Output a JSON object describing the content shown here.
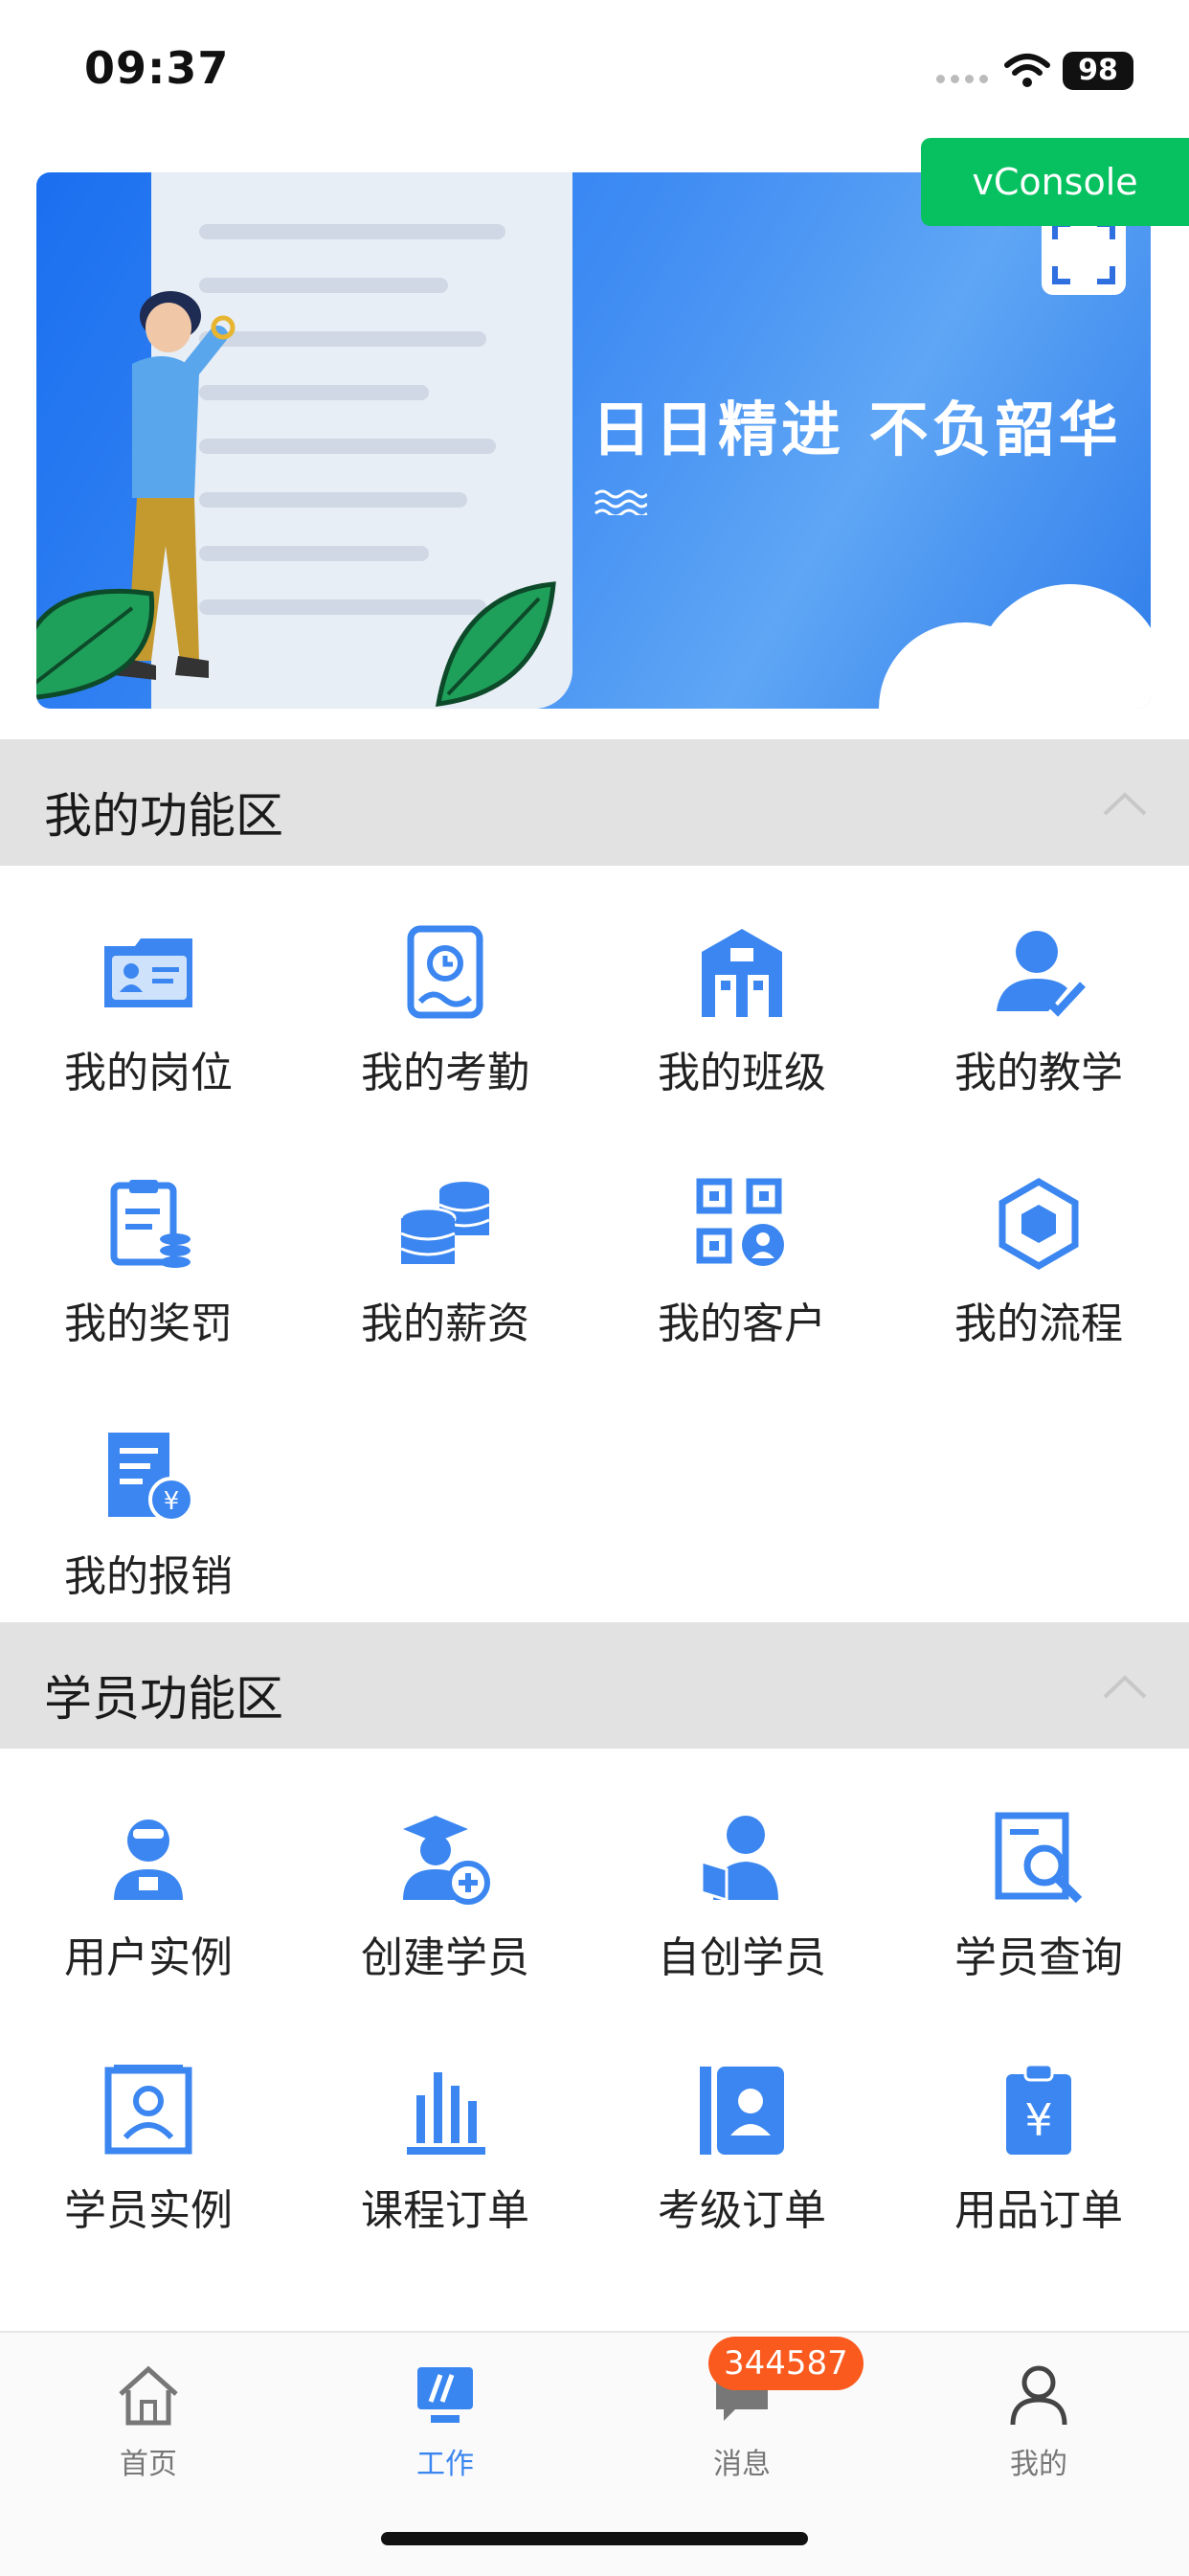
{
  "status_bar": {
    "time": "09:37",
    "battery": "98"
  },
  "banner": {
    "slogan": "日日精进 不负韶华"
  },
  "vconsole": {
    "label": "vConsole"
  },
  "sections": [
    {
      "title": "我的功能区",
      "items": [
        {
          "label": "我的岗位",
          "icon": "id-card-icon"
        },
        {
          "label": "我的考勤",
          "icon": "attendance-clock-icon"
        },
        {
          "label": "我的班级",
          "icon": "classroom-building-icon"
        },
        {
          "label": "我的教学",
          "icon": "teacher-check-icon"
        },
        {
          "label": "我的奖罚",
          "icon": "reward-clipboard-icon"
        },
        {
          "label": "我的薪资",
          "icon": "coin-stack-icon"
        },
        {
          "label": "我的客户",
          "icon": "qr-user-icon"
        },
        {
          "label": "我的流程",
          "icon": "flow-hexagon-icon"
        },
        {
          "label": "我的报销",
          "icon": "reimburse-receipt-icon"
        }
      ]
    },
    {
      "title": "学员功能区",
      "items": [
        {
          "label": "用户实例",
          "icon": "user-headset-icon"
        },
        {
          "label": "创建学员",
          "icon": "graduate-add-icon"
        },
        {
          "label": "自创学员",
          "icon": "student-book-icon"
        },
        {
          "label": "学员查询",
          "icon": "search-document-icon"
        },
        {
          "label": "学员实例",
          "icon": "user-frame-icon"
        },
        {
          "label": "课程订单",
          "icon": "bar-chart-icon"
        },
        {
          "label": "考级订单",
          "icon": "contact-book-icon"
        },
        {
          "label": "用品订单",
          "icon": "yuan-tag-icon"
        }
      ]
    }
  ],
  "tab_bar": {
    "tabs": [
      {
        "label": "首页",
        "icon": "home-icon"
      },
      {
        "label": "工作",
        "icon": "work-icon",
        "active": true
      },
      {
        "label": "消息",
        "icon": "message-icon"
      },
      {
        "label": "我的",
        "icon": "profile-icon"
      }
    ],
    "message_badge": "344587"
  },
  "colors": {
    "accent": "#3a86f0",
    "badge": "#fa5a1e",
    "vconsole": "#07c160",
    "section_bg": "#e2e2e2"
  }
}
